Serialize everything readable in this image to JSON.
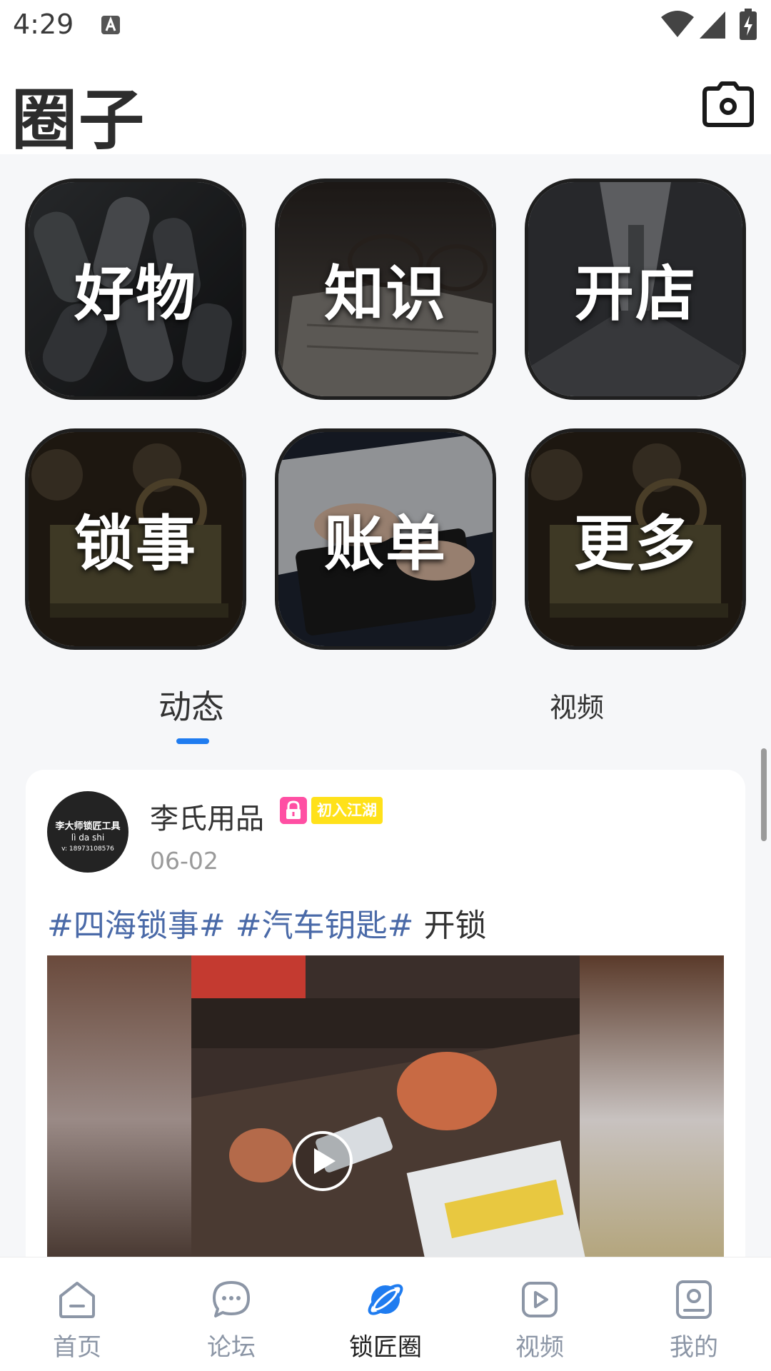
{
  "status_bar": {
    "time": "4:29"
  },
  "header": {
    "title": "圈子",
    "camera_icon": "camera-icon"
  },
  "categories": [
    {
      "label": "好物",
      "theme": "car-keys"
    },
    {
      "label": "知识",
      "theme": "glasses-book"
    },
    {
      "label": "开店",
      "theme": "city-street"
    },
    {
      "label": "锁事",
      "theme": "antique-lock"
    },
    {
      "label": "账单",
      "theme": "calculator"
    },
    {
      "label": "更多",
      "theme": "antique-lock"
    }
  ],
  "feed_tabs": [
    {
      "label": "动态",
      "active": true
    },
    {
      "label": "视频",
      "active": false
    }
  ],
  "post": {
    "avatar": {
      "line1": "李大师锁匠工具",
      "line2": "lì da shi",
      "line3": "v: 18973108576"
    },
    "author": "李氏用品",
    "level_badge": "初入江湖",
    "date": "06-02",
    "tags": [
      "#四海锁事#",
      "#汽车钥匙#"
    ],
    "text": "开锁",
    "media_icon": "play-icon"
  },
  "bottom_nav": [
    {
      "label": "首页",
      "icon": "home-icon",
      "active": false
    },
    {
      "label": "论坛",
      "icon": "chat-icon",
      "active": false
    },
    {
      "label": "锁匠圈",
      "icon": "planet-icon",
      "active": true
    },
    {
      "label": "视频",
      "icon": "video-icon",
      "active": false
    },
    {
      "label": "我的",
      "icon": "profile-icon",
      "active": false
    }
  ],
  "colors": {
    "accent": "#1f7cf0",
    "tag": "#4a6aa8",
    "lock_badge": "#ff4fa3",
    "level_badge": "#ffe11a",
    "nav_inactive": "#8c96a6"
  }
}
